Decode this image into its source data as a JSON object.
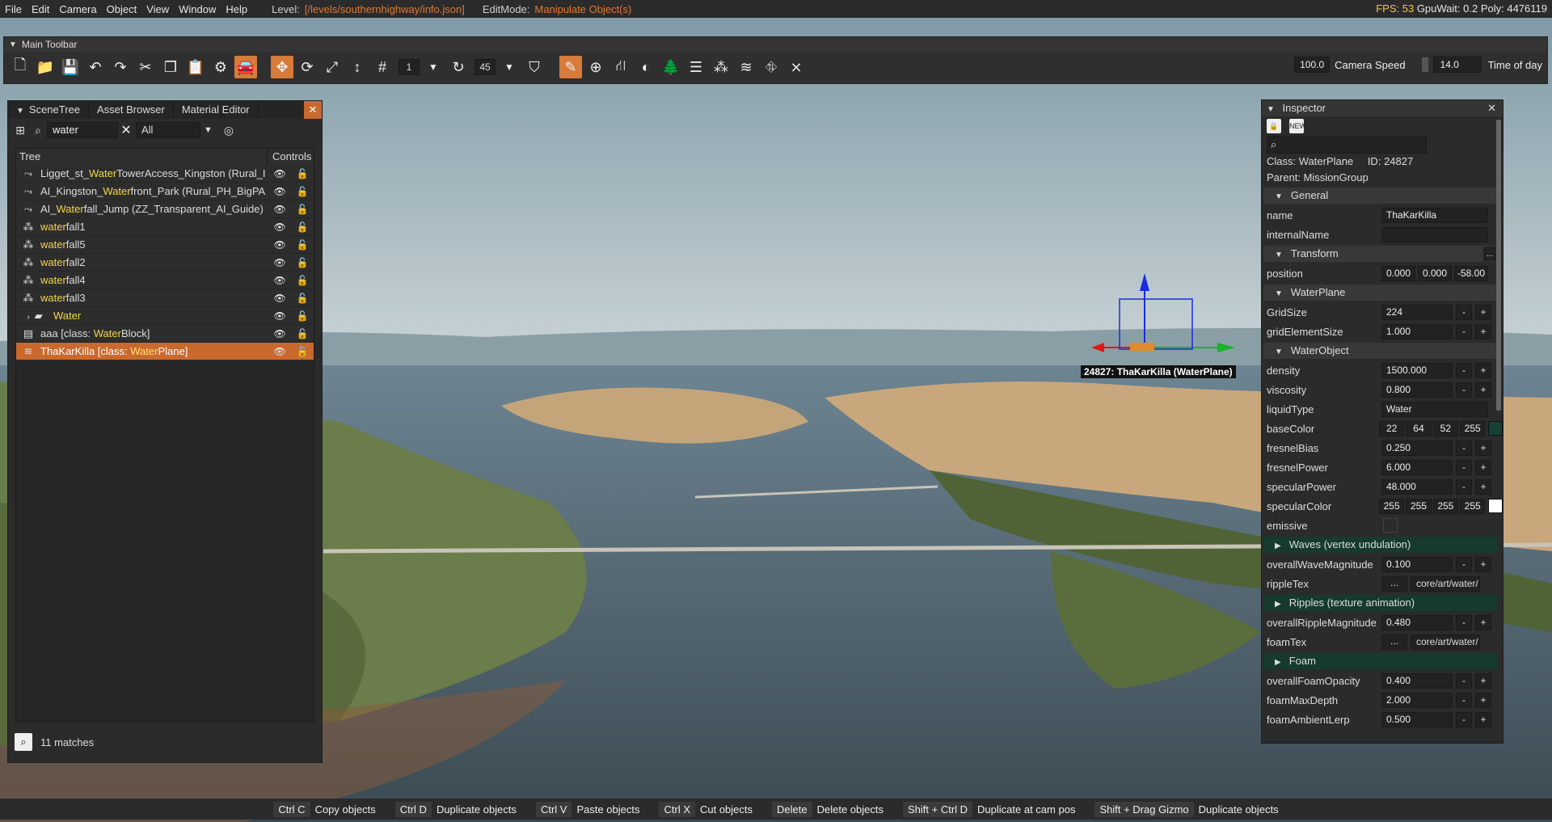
{
  "menu": {
    "items": [
      "File",
      "Edit",
      "Camera",
      "Object",
      "View",
      "Window",
      "Help"
    ],
    "level_label": "Level:",
    "level_value": "[/levels/southernhighway/info.json]",
    "editmode_label": "EditMode:",
    "editmode_value": "Manipulate Object(s)",
    "fps": "FPS: 53",
    "gpuwait": "GpuWait: 0.2",
    "poly": "Poly: 4476119"
  },
  "toolbar": {
    "title": "Main Toolbar",
    "snap_value": "1",
    "rot_snap_value": "45",
    "camera_speed_value": "100.0",
    "camera_speed_label": "Camera Speed",
    "time_value": "14.0",
    "time_label": "Time of day"
  },
  "scenetree": {
    "tabs": [
      "SceneTree",
      "Asset Browser",
      "Material Editor"
    ],
    "search_value": "water",
    "filter_value": "All",
    "col_tree": "Tree",
    "col_controls": "Controls",
    "rows": [
      {
        "pre": "Ligget_st_",
        "hl": "Water",
        "post": "TowerAccess_Kingston (Rural_I",
        "icon": "path"
      },
      {
        "pre": "AI_Kingston_",
        "hl": "Water",
        "post": "front_Park (Rural_PH_BigPA",
        "icon": "path"
      },
      {
        "pre": "AI_",
        "hl": "Water",
        "post": "fall_Jump (ZZ_Transparent_AI_Guide)",
        "icon": "path"
      },
      {
        "pre": "",
        "hl": "water",
        "post": "fall1",
        "icon": "particle"
      },
      {
        "pre": "",
        "hl": "water",
        "post": "fall5",
        "icon": "particle"
      },
      {
        "pre": "",
        "hl": "water",
        "post": "fall2",
        "icon": "particle"
      },
      {
        "pre": "",
        "hl": "water",
        "post": "fall4",
        "icon": "particle"
      },
      {
        "pre": "",
        "hl": "water",
        "post": "fall3",
        "icon": "particle"
      },
      {
        "pre": "",
        "hl": "Water",
        "post": "",
        "icon": "folder"
      },
      {
        "pre": "aaa [class: ",
        "hl": "Water",
        "post": "Block]",
        "icon": "block"
      },
      {
        "pre": "ThaKarKilla [class: ",
        "hl": "Water",
        "post": "Plane]",
        "icon": "waves"
      }
    ],
    "matches": "11 matches"
  },
  "inspector": {
    "title": "Inspector",
    "class_label": "Class:",
    "class_value": "WaterPlane",
    "id_label": "ID:",
    "id_value": "24827",
    "parent_label": "Parent:",
    "parent_value": "MissionGroup",
    "sec_general": "General",
    "name_label": "name",
    "name_value": "ThaKarKilla",
    "internalName_label": "internalName",
    "sec_transform": "Transform",
    "position_label": "position",
    "pos_x": "0.000",
    "pos_y": "0.000",
    "pos_z": "-58.00",
    "sec_waterplane": "WaterPlane",
    "gridSize_label": "GridSize",
    "gridSize_value": "224",
    "gridElementSize_label": "gridElementSize",
    "gridElementSize_value": "1.000",
    "sec_waterobject": "WaterObject",
    "density_label": "density",
    "density_value": "1500.000",
    "viscosity_label": "viscosity",
    "viscosity_value": "0.800",
    "liquidType_label": "liquidType",
    "liquidType_value": "Water",
    "baseColor_label": "baseColor",
    "baseColor_r": "22",
    "baseColor_g": "64",
    "baseColor_b": "52",
    "baseColor_a": "255",
    "fresnelBias_label": "fresnelBias",
    "fresnelBias_value": "0.250",
    "fresnelPower_label": "fresnelPower",
    "fresnelPower_value": "6.000",
    "specularPower_label": "specularPower",
    "specularPower_value": "48.000",
    "specularColor_label": "specularColor",
    "specularColor_r": "255",
    "specularColor_g": "255",
    "specularColor_b": "255",
    "specularColor_a": "255",
    "emissive_label": "emissive",
    "sec_waves": "Waves (vertex undulation)",
    "overallWaveMagnitude_label": "overallWaveMagnitude",
    "overallWaveMagnitude_value": "0.100",
    "rippleTex_label": "rippleTex",
    "rippleTex_value": "core/art/water/",
    "sec_ripples": "Ripples (texture animation)",
    "overallRippleMagnitude_label": "overallRippleMagnitude",
    "overallRippleMagnitude_value": "0.480",
    "foamTex_label": "foamTex",
    "foamTex_value": "core/art/water/",
    "sec_foam": "Foam",
    "overallFoamOpacity_label": "overallFoamOpacity",
    "overallFoamOpacity_value": "0.400",
    "foamMaxDepth_label": "foamMaxDepth",
    "foamMaxDepth_value": "2.000",
    "foamAmbientLerp_label": "foamAmbientLerp",
    "foamAmbientLerp_value": "0.500",
    "dots": "...",
    "minus": "-",
    "plus": "+",
    "new_badge": "NEW"
  },
  "gizmo_label": "24827: ThaKarKilla (WaterPlane)",
  "shortcuts": [
    {
      "key": "Ctrl C",
      "desc": "Copy objects"
    },
    {
      "key": "Ctrl D",
      "desc": "Duplicate objects"
    },
    {
      "key": "Ctrl V",
      "desc": "Paste objects"
    },
    {
      "key": "Ctrl X",
      "desc": "Cut objects"
    },
    {
      "key": "Delete",
      "desc": "Delete objects"
    },
    {
      "key": "Shift + Ctrl D",
      "desc": "Duplicate at cam pos"
    },
    {
      "key": "Shift + Drag Gizmo",
      "desc": "Duplicate objects"
    }
  ],
  "colors": {
    "accent": "#c9692e",
    "highlight": "#f2d74a",
    "section_dark": "#163a2e",
    "baseColor_swatch": "#164034",
    "specular_swatch": "#ffffff"
  }
}
